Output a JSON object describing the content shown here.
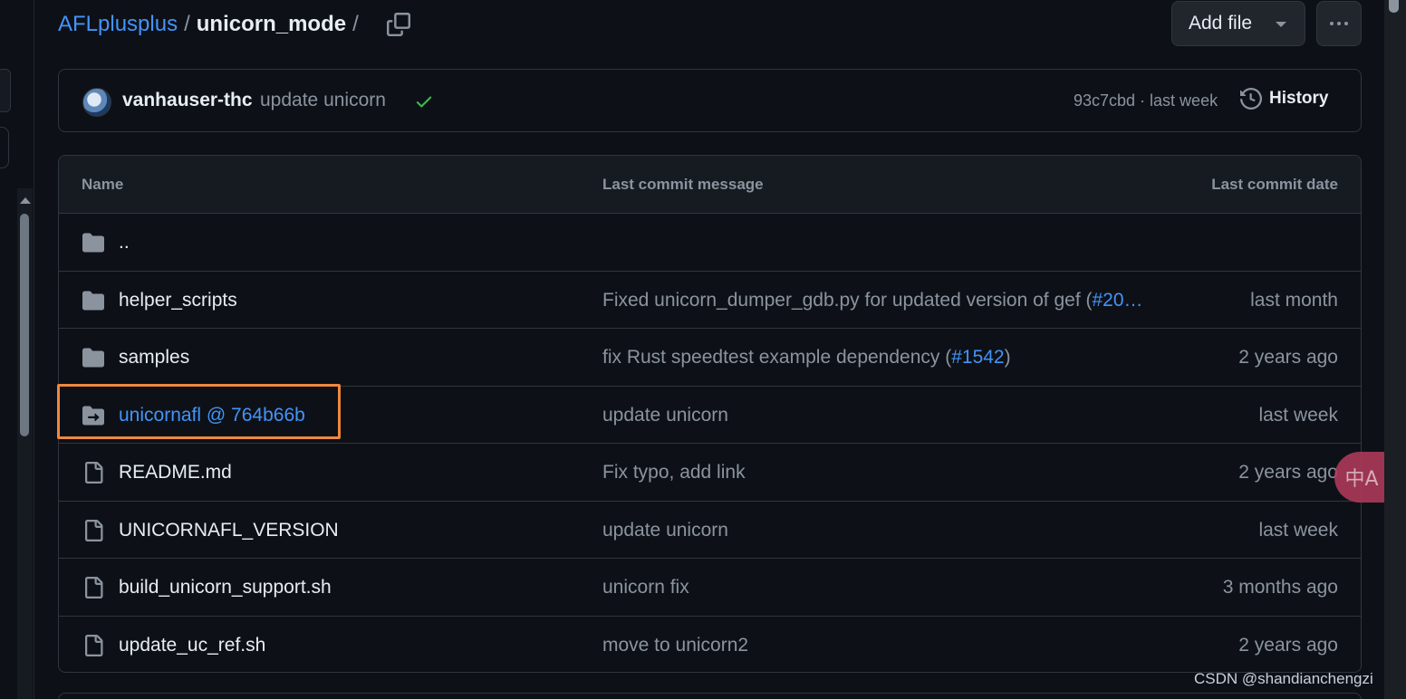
{
  "breadcrumb": {
    "repo": "AFLplusplus",
    "separator": "/",
    "current": "unicorn_mode",
    "trailing_separator": "/"
  },
  "toolbar": {
    "add_file_label": "Add file",
    "copy_icon": "copy-icon",
    "more_icon": "kebab-horizontal-icon"
  },
  "latest_commit": {
    "author": "vanhauser-thc",
    "message": "update unicorn",
    "status_icon": "check-icon",
    "hash_and_time": "93c7cbd · last week",
    "history_label": "History"
  },
  "table": {
    "headers": {
      "name": "Name",
      "message": "Last commit message",
      "date": "Last commit date"
    },
    "rows": [
      {
        "icon": "folder-icon",
        "name": "..",
        "message": "",
        "message_link": "",
        "message_suffix": "",
        "date": ""
      },
      {
        "icon": "folder-icon",
        "name": "helper_scripts",
        "message": "Fixed unicorn_dumper_gdb.py for updated version of gef (",
        "message_link": "#20…",
        "message_suffix": "",
        "date": "last month"
      },
      {
        "icon": "folder-icon",
        "name": "samples",
        "message": "fix Rust speedtest example dependency (",
        "message_link": "#1542",
        "message_suffix": ")",
        "date": "2 years ago"
      },
      {
        "icon": "submodule-icon",
        "name": "unicornafl @ 764b66b",
        "message": "update unicorn",
        "message_link": "",
        "message_suffix": "",
        "date": "last week"
      },
      {
        "icon": "file-icon",
        "name": "README.md",
        "message": "Fix typo, add link",
        "message_link": "",
        "message_suffix": "",
        "date": "2 years ago"
      },
      {
        "icon": "file-icon",
        "name": "UNICORNAFL_VERSION",
        "message": "update unicorn",
        "message_link": "",
        "message_suffix": "",
        "date": "last week"
      },
      {
        "icon": "file-icon",
        "name": "build_unicorn_support.sh",
        "message": "unicorn fix",
        "message_link": "",
        "message_suffix": "",
        "date": "3 months ago"
      },
      {
        "icon": "file-icon",
        "name": "update_uc_ref.sh",
        "message": "move to unicorn2",
        "message_link": "",
        "message_suffix": "",
        "date": "2 years ago"
      }
    ]
  },
  "overlay": {
    "translate_glyph": "中A",
    "watermark": "CSDN @shandianchengzi"
  },
  "colors": {
    "background": "#0d1117",
    "border": "#30363d",
    "link": "#4493f8",
    "muted": "#8b949e",
    "success": "#3fb950",
    "highlight": "#f0883e"
  }
}
